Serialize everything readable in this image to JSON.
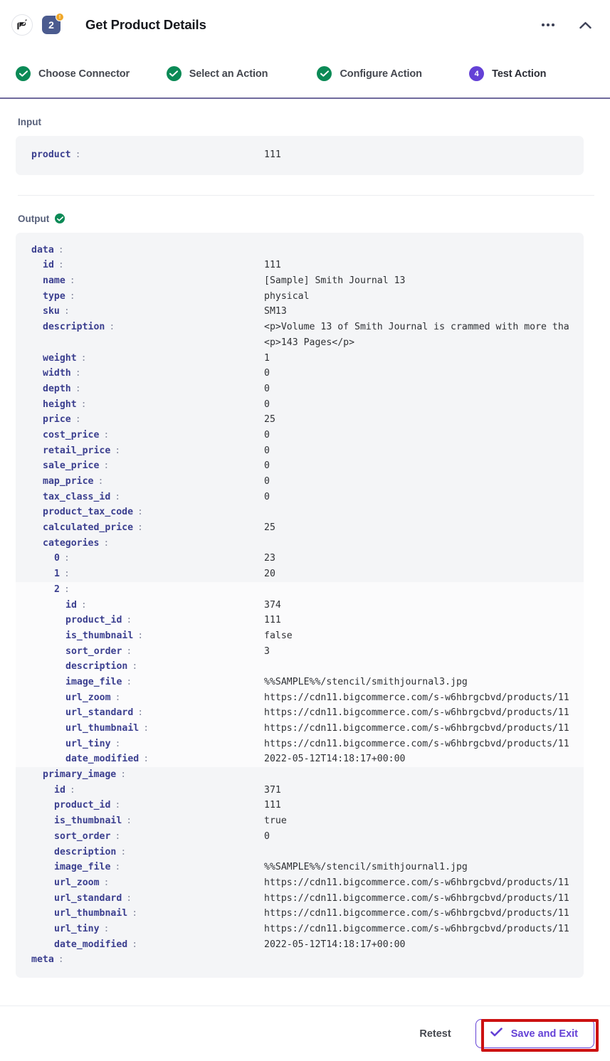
{
  "header": {
    "title": "Get Product Details",
    "step_number": "2",
    "badge_mark": "!",
    "more_icon": "ellipsis-icon",
    "collapse_icon": "chevron-up-icon",
    "logo_icon": "bigcommerce-logo-icon"
  },
  "steps": [
    {
      "label": "Choose Connector",
      "state": "done",
      "marker": "check"
    },
    {
      "label": "Select an Action",
      "state": "done",
      "marker": "check"
    },
    {
      "label": "Configure Action",
      "state": "done",
      "marker": "check"
    },
    {
      "label": "Test Action",
      "state": "current",
      "marker": "4"
    }
  ],
  "input": {
    "label": "Input",
    "rows": [
      {
        "key": "product",
        "value": "111",
        "indent": 0
      }
    ]
  },
  "output": {
    "label": "Output",
    "status_icon": "check-circle-icon",
    "rows": [
      {
        "key": "data",
        "value": "",
        "indent": 0
      },
      {
        "key": "id",
        "value": "111",
        "indent": 1
      },
      {
        "key": "name",
        "value": "[Sample] Smith Journal 13",
        "indent": 1
      },
      {
        "key": "type",
        "value": "physical",
        "indent": 1
      },
      {
        "key": "sku",
        "value": "SM13",
        "indent": 1
      },
      {
        "key": "description",
        "value": "<p>Volume 13 of Smith Journal is crammed with more tha\n<p>143 Pages</p>",
        "indent": 1,
        "tall": true
      },
      {
        "key": "weight",
        "value": "1",
        "indent": 1
      },
      {
        "key": "width",
        "value": "0",
        "indent": 1
      },
      {
        "key": "depth",
        "value": "0",
        "indent": 1
      },
      {
        "key": "height",
        "value": "0",
        "indent": 1
      },
      {
        "key": "price",
        "value": "25",
        "indent": 1
      },
      {
        "key": "cost_price",
        "value": "0",
        "indent": 1
      },
      {
        "key": "retail_price",
        "value": "0",
        "indent": 1
      },
      {
        "key": "sale_price",
        "value": "0",
        "indent": 1
      },
      {
        "key": "map_price",
        "value": "0",
        "indent": 1
      },
      {
        "key": "tax_class_id",
        "value": "0",
        "indent": 1
      },
      {
        "key": "product_tax_code",
        "value": "",
        "indent": 1
      },
      {
        "key": "calculated_price",
        "value": "25",
        "indent": 1
      },
      {
        "key": "categories",
        "value": "",
        "indent": 1
      },
      {
        "key": "0",
        "value": "23",
        "indent": 2
      },
      {
        "key": "1",
        "value": "20",
        "indent": 2
      },
      {
        "key": "2",
        "value": "",
        "indent": 2,
        "alt": true
      },
      {
        "key": "id",
        "value": "374",
        "indent": 3,
        "alt": true
      },
      {
        "key": "product_id",
        "value": "111",
        "indent": 3,
        "alt": true
      },
      {
        "key": "is_thumbnail",
        "value": "false",
        "indent": 3,
        "alt": true
      },
      {
        "key": "sort_order",
        "value": "3",
        "indent": 3,
        "alt": true
      },
      {
        "key": "description",
        "value": "",
        "indent": 3,
        "alt": true
      },
      {
        "key": "image_file",
        "value": "%%SAMPLE%%/stencil/smithjournal3.jpg",
        "indent": 3,
        "alt": true
      },
      {
        "key": "url_zoom",
        "value": "https://cdn11.bigcommerce.com/s-w6hbrgcbvd/products/11",
        "indent": 3,
        "alt": true
      },
      {
        "key": "url_standard",
        "value": "https://cdn11.bigcommerce.com/s-w6hbrgcbvd/products/11",
        "indent": 3,
        "alt": true
      },
      {
        "key": "url_thumbnail",
        "value": "https://cdn11.bigcommerce.com/s-w6hbrgcbvd/products/11",
        "indent": 3,
        "alt": true
      },
      {
        "key": "url_tiny",
        "value": "https://cdn11.bigcommerce.com/s-w6hbrgcbvd/products/11",
        "indent": 3,
        "alt": true
      },
      {
        "key": "date_modified",
        "value": "2022-05-12T14:18:17+00:00",
        "indent": 3,
        "alt": true
      },
      {
        "key": "primary_image",
        "value": "",
        "indent": 1
      },
      {
        "key": "id",
        "value": "371",
        "indent": 2
      },
      {
        "key": "product_id",
        "value": "111",
        "indent": 2
      },
      {
        "key": "is_thumbnail",
        "value": "true",
        "indent": 2
      },
      {
        "key": "sort_order",
        "value": "0",
        "indent": 2
      },
      {
        "key": "description",
        "value": "",
        "indent": 2
      },
      {
        "key": "image_file",
        "value": "%%SAMPLE%%/stencil/smithjournal1.jpg",
        "indent": 2
      },
      {
        "key": "url_zoom",
        "value": "https://cdn11.bigcommerce.com/s-w6hbrgcbvd/products/11",
        "indent": 2
      },
      {
        "key": "url_standard",
        "value": "https://cdn11.bigcommerce.com/s-w6hbrgcbvd/products/11",
        "indent": 2
      },
      {
        "key": "url_thumbnail",
        "value": "https://cdn11.bigcommerce.com/s-w6hbrgcbvd/products/11",
        "indent": 2
      },
      {
        "key": "url_tiny",
        "value": "https://cdn11.bigcommerce.com/s-w6hbrgcbvd/products/11",
        "indent": 2
      },
      {
        "key": "date_modified",
        "value": "2022-05-12T14:18:17+00:00",
        "indent": 2
      },
      {
        "key": "meta",
        "value": "",
        "indent": 0
      }
    ]
  },
  "footer": {
    "retest_label": "Retest",
    "save_label": "Save and Exit",
    "save_icon": "check-icon"
  },
  "colors": {
    "accent_purple": "#6441d6",
    "step_divider": "#6f6a9c",
    "success_green": "#0b8a56",
    "key_blue": "#3b3f8f",
    "panel_bg": "#f4f5f7",
    "highlight_red": "#cc1111",
    "badge_blue": "#4b5b8f",
    "badge_orange": "#f0a82a"
  }
}
